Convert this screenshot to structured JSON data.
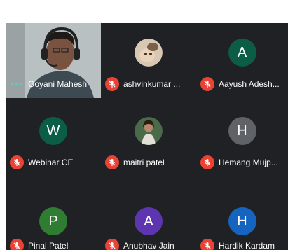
{
  "participants": [
    {
      "name": "Goyani Mahesh",
      "type": "video",
      "speaking": true
    },
    {
      "name": "ashvinkumar ...",
      "type": "photo",
      "muted": true
    },
    {
      "name": "Aayush Adesh...",
      "initial": "A",
      "color": "#0b5d46",
      "muted": true
    },
    {
      "name": "Webinar CE",
      "initial": "W",
      "color": "#0b5d46",
      "muted": true
    },
    {
      "name": "maitri patel",
      "type": "photo",
      "muted": true
    },
    {
      "name": "Hemang Mujp...",
      "initial": "H",
      "color": "#5f6368",
      "muted": true
    },
    {
      "name": "Pinal Patel",
      "initial": "P",
      "color": "#2e7d32",
      "muted": true
    },
    {
      "name": "Anubhav Jain",
      "initial": "A",
      "color": "#5e35b1",
      "muted": true
    },
    {
      "name": "Hardik Kardam",
      "initial": "H",
      "color": "#1565c0",
      "muted": true
    }
  ],
  "icons": {
    "muted": "mic-off-icon",
    "speaking": "speaking-dots-icon"
  }
}
